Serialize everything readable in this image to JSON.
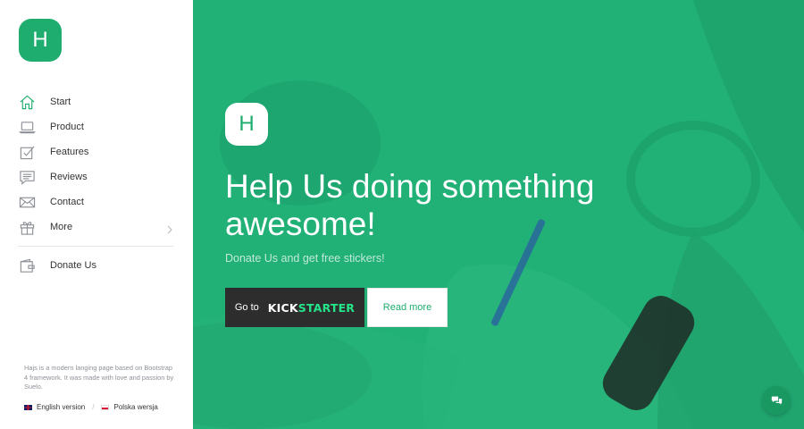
{
  "brand": {
    "logo_letter": "H"
  },
  "sidebar": {
    "items": [
      {
        "label": "Start",
        "icon": "home-icon"
      },
      {
        "label": "Product",
        "icon": "laptop-icon"
      },
      {
        "label": "Features",
        "icon": "checkbox-icon"
      },
      {
        "label": "Reviews",
        "icon": "speech-bubble-icon"
      },
      {
        "label": "Contact",
        "icon": "envelope-icon"
      },
      {
        "label": "More",
        "icon": "gift-icon"
      }
    ],
    "donate": {
      "label": "Donate Us",
      "icon": "wallet-icon"
    },
    "footnote": "Hajs is a modern langing page based on Bootstrap 4 framework. It was made with love and passion by Suelo.",
    "languages": [
      {
        "label": "English version",
        "flag": "uk-flag-icon"
      },
      {
        "label": "Polska wersja",
        "flag": "pl-flag-icon"
      }
    ],
    "lang_separator": "/"
  },
  "hero": {
    "logo_letter": "H",
    "title": "Help Us doing something awesome!",
    "subtitle": "Donate Us and get free stickers!",
    "kickstarter_prefix": "Go to",
    "kickstarter_brand_1": "KICK",
    "kickstarter_brand_2": "STARTER",
    "read_more": "Read more"
  },
  "colors": {
    "accent": "#1ead6e",
    "hero_bg": "#21b076",
    "dark_button": "#2d2d2d",
    "kickstarter_green": "#25e58a"
  }
}
